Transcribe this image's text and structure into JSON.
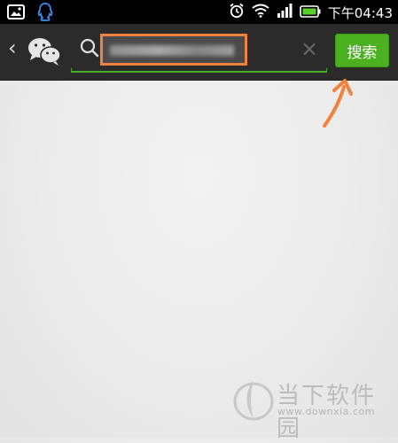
{
  "statusbar": {
    "time": "下午04:43",
    "icons": [
      "gallery-icon",
      "qq-icon",
      "alarm-icon",
      "wifi-icon",
      "signal-icon",
      "battery-icon"
    ]
  },
  "toolbar": {
    "back_glyph": "‹",
    "clear_glyph": "×",
    "search_button_label": "搜索",
    "search_value_blurred": true,
    "accent": "#4cb120",
    "highlight": "#f0823c"
  },
  "watermark": {
    "title": "当下软件园",
    "url": "www.downxia.com"
  }
}
